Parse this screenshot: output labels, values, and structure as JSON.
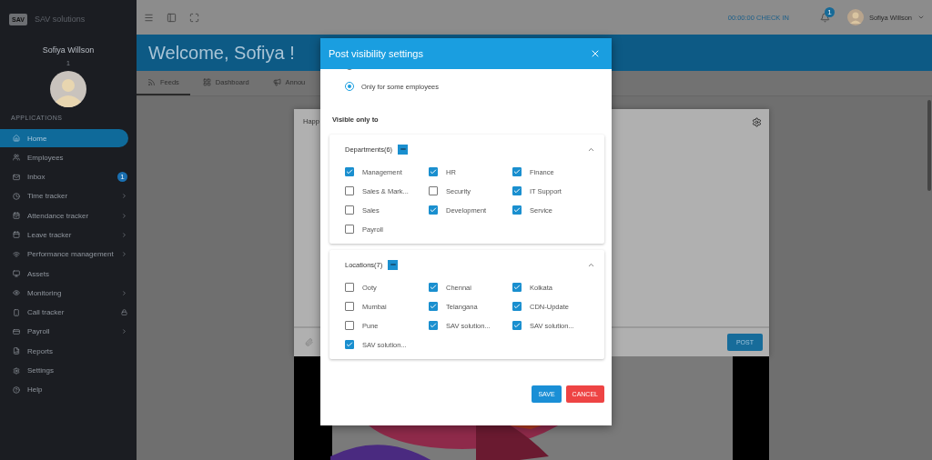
{
  "sidebar": {
    "brand_logo": "SAV",
    "brand": "SAV solutions",
    "user_name": "Sofiya Willson",
    "user_subtitle": "1",
    "section": "APPLICATIONS",
    "items": [
      {
        "label": "Home",
        "kind": "plain",
        "selected": true
      },
      {
        "label": "Employees",
        "kind": "plain",
        "selected": false
      },
      {
        "label": "Inbox",
        "kind": "badge",
        "badge": "1",
        "selected": false
      },
      {
        "label": "Time tracker",
        "kind": "submenu",
        "selected": false
      },
      {
        "label": "Attendance tracker",
        "kind": "submenu",
        "selected": false
      },
      {
        "label": "Leave tracker",
        "kind": "submenu",
        "selected": false
      },
      {
        "label": "Performance management",
        "kind": "submenu",
        "selected": false
      },
      {
        "label": "Assets",
        "kind": "plain",
        "selected": false
      },
      {
        "label": "Monitoring",
        "kind": "submenu",
        "selected": false
      },
      {
        "label": "Call tracker",
        "kind": "locked",
        "selected": false
      },
      {
        "label": "Payroll",
        "kind": "submenu",
        "selected": false
      },
      {
        "label": "Reports",
        "kind": "plain",
        "selected": false
      },
      {
        "label": "Settings",
        "kind": "plain",
        "selected": false
      },
      {
        "label": "Help",
        "kind": "plain",
        "selected": false
      }
    ]
  },
  "topbar": {
    "timer": "00:00:00 CHECK IN",
    "notifications": "1",
    "user_name": "Sofiya Willson"
  },
  "banner": {
    "title": "Welcome, Sofiya !"
  },
  "tabs": [
    {
      "label": "Feeds",
      "selected": true
    },
    {
      "label": "Dashboard",
      "selected": false
    },
    {
      "label": "Annou",
      "selected": false
    }
  ],
  "post": {
    "text": "Happ",
    "button": "POST"
  },
  "modal": {
    "title": "Post visibility settings",
    "options": [
      {
        "selected": false
      },
      {
        "label": "Only for some employees",
        "selected": true
      }
    ],
    "visible_label": "Visible only to",
    "groups": [
      {
        "title": "Departments(6)",
        "partial": true,
        "expanded": true,
        "items": [
          {
            "label": "Management",
            "checked": true
          },
          {
            "label": "HR",
            "checked": true
          },
          {
            "label": "Finance",
            "checked": true
          },
          {
            "label": "Sales & Mark...",
            "checked": false
          },
          {
            "label": "Security",
            "checked": false
          },
          {
            "label": "IT Support",
            "checked": true
          },
          {
            "label": "Sales",
            "checked": false
          },
          {
            "label": "Development",
            "checked": true
          },
          {
            "label": "Service",
            "checked": true
          },
          {
            "label": "Payroll",
            "checked": false
          }
        ]
      },
      {
        "title": "Locations(7)",
        "partial": true,
        "expanded": true,
        "items": [
          {
            "label": "Ooty",
            "checked": false
          },
          {
            "label": "Chennai",
            "checked": true
          },
          {
            "label": "Kolkata",
            "checked": true
          },
          {
            "label": "Mumbai",
            "checked": false
          },
          {
            "label": "Telangana",
            "checked": true
          },
          {
            "label": "CDN-Update",
            "checked": true
          },
          {
            "label": "Pune",
            "checked": false
          },
          {
            "label": "SAV solution...",
            "checked": true
          },
          {
            "label": "SAV solution...",
            "checked": true
          },
          {
            "label": "SAV solution...",
            "checked": true
          }
        ]
      }
    ],
    "actions": [
      {
        "label": "SAVE",
        "kind": "primary"
      },
      {
        "label": "CANCEL",
        "kind": "danger"
      }
    ]
  }
}
